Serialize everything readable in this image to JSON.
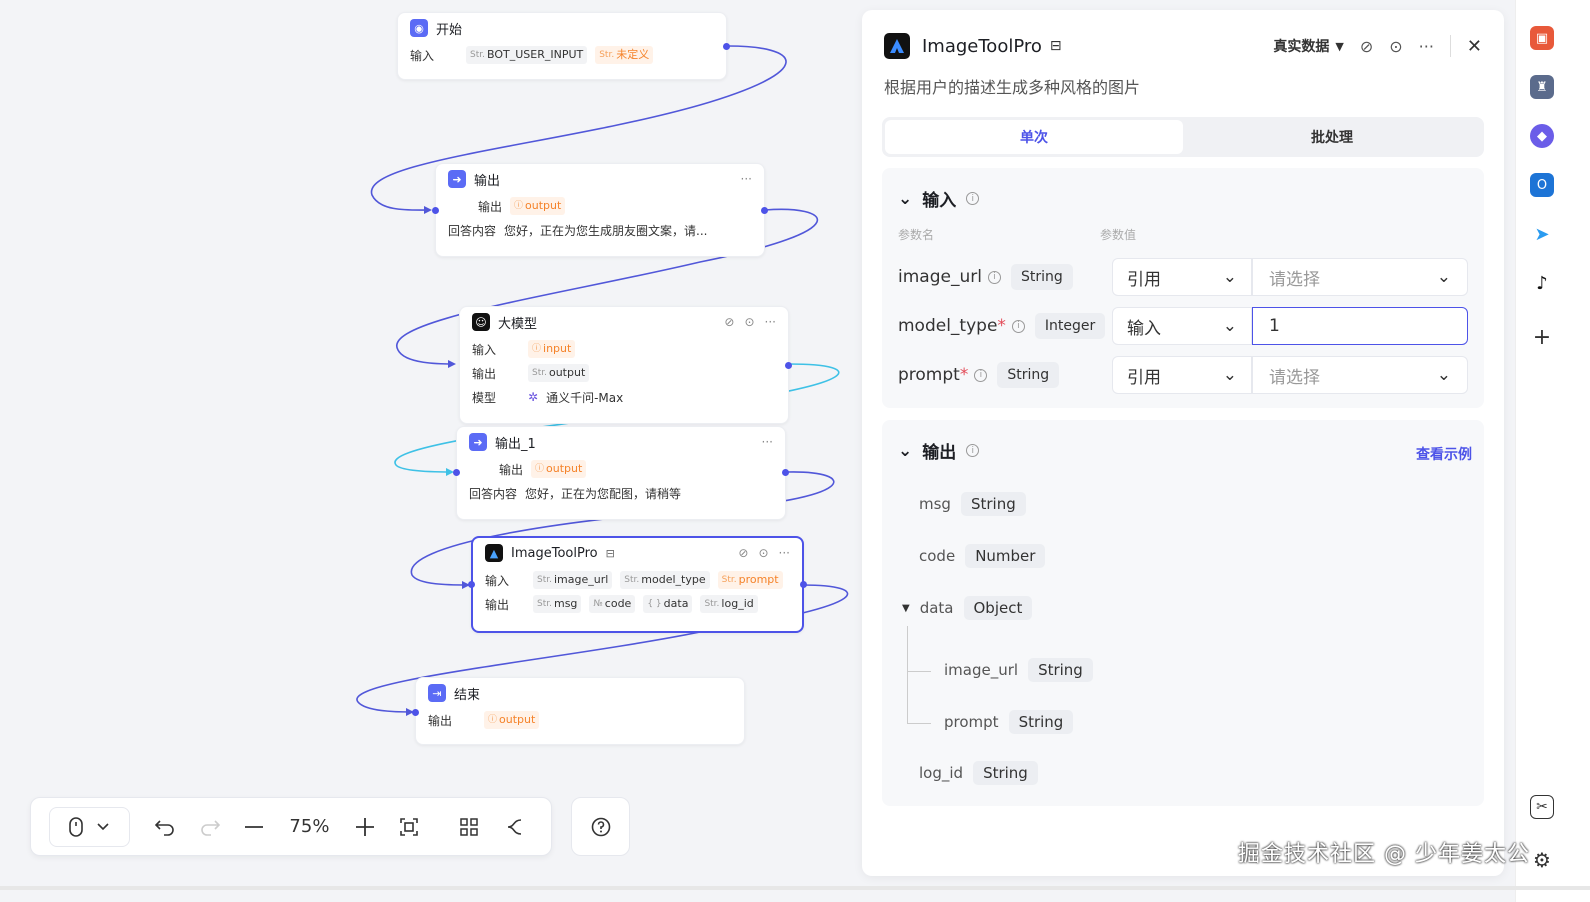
{
  "nodes": {
    "start": {
      "title": "开始",
      "in_label": "输入",
      "params": [
        {
          "pfx": "Str.",
          "name": "BOT_USER_INPUT",
          "warn": false
        },
        {
          "pfx": "Str.",
          "name": "未定义",
          "warn": true
        }
      ]
    },
    "out": {
      "title": "输出",
      "more": "···",
      "r1_label": "输出",
      "r1_tag": "output",
      "r2_label": "回答内容",
      "r2_text": "您好，正在为您生成朋友圈文案，请..."
    },
    "llm": {
      "title": "大模型",
      "more": "···",
      "r1_label": "输入",
      "r1_tag": "input",
      "r2_label": "输出",
      "r2_pfx": "Str.",
      "r2_tag": "output",
      "r3_label": "模型",
      "r3_text": "通义千问-Max"
    },
    "out1": {
      "title": "输出_1",
      "more": "···",
      "r1_label": "输出",
      "r1_tag": "output",
      "r2_label": "回答内容",
      "r2_text": "您好，正在为您配图，请稍等"
    },
    "tool": {
      "title": "ImageToolPro",
      "more": "···",
      "in_label": "输入",
      "inputs": [
        {
          "pfx": "Str.",
          "name": "image_url"
        },
        {
          "pfx": "Str.",
          "name": "model_type"
        },
        {
          "pfx": "Str.",
          "name": "prompt"
        }
      ],
      "out_label": "输出",
      "outputs": [
        {
          "pfx": "Str.",
          "name": "msg"
        },
        {
          "pfx": "№",
          "name": "code"
        },
        {
          "pfx": "{ }",
          "name": "data"
        },
        {
          "pfx": "Str.",
          "name": "log_id"
        }
      ]
    },
    "end": {
      "title": "结束",
      "r1_label": "输出",
      "r1_tag": "output"
    }
  },
  "toolbar": {
    "zoom": "75%",
    "mouse_icon": "mouse-icon",
    "help_icon": "help-icon"
  },
  "panel": {
    "title": "ImageToolPro",
    "data_mode": "真实数据",
    "more": "···",
    "description": "根据用户的描述生成多种风格的图片",
    "tabs": [
      "单次",
      "批处理"
    ],
    "input_section": {
      "title": "输入",
      "col_name": "参数名",
      "col_value": "参数值",
      "params": [
        {
          "name": "image_url",
          "required": false,
          "type": "String",
          "mode": "引用",
          "value": "请选择",
          "is_input": false
        },
        {
          "name": "model_type",
          "required": true,
          "type": "Integer",
          "mode": "输入",
          "value": "1",
          "is_input": true
        },
        {
          "name": "prompt",
          "required": true,
          "type": "String",
          "mode": "引用",
          "value": "请选择",
          "is_input": false
        }
      ]
    },
    "output_section": {
      "title": "输出",
      "see_example": "查看示例",
      "fields": [
        {
          "name": "msg",
          "type": "String"
        },
        {
          "name": "code",
          "type": "Number"
        },
        {
          "name": "data",
          "type": "Object"
        },
        {
          "name": "image_url",
          "type": "String"
        },
        {
          "name": "prompt",
          "type": "String"
        },
        {
          "name": "log_id",
          "type": "String"
        }
      ]
    }
  },
  "watermark": "掘金技术社区 @ 少年姜太公",
  "colors": {
    "accent": "#4d53e8",
    "edge": "#5157d9",
    "edge_active": "#3ec1e6",
    "warn": "#f5832a"
  }
}
